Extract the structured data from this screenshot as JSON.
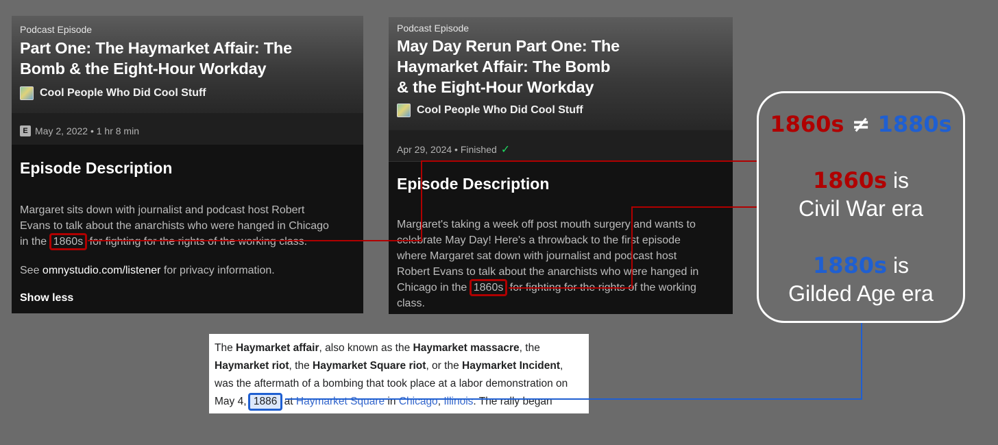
{
  "left_card": {
    "kicker": "Podcast Episode",
    "title_line1": "Part One: The Haymarket Affair: The",
    "title_line2": "Bomb & the Eight-Hour Workday",
    "show_name": "Cool People Who Did Cool Stuff",
    "explicit_badge": "E",
    "meta": "May 2, 2022 • 1 hr 8 min",
    "description_heading": "Episode Description",
    "desc_line1": "Margaret sits down with journalist and podcast host Robert",
    "desc_line2": "Evans to talk about the anarchists who were hanged in Chicago",
    "desc_line3_pre": "in the",
    "desc_decade": "1860s",
    "desc_line3_post": "for fighting for the rights of the working class.",
    "privacy_pre": "See",
    "privacy_link": "omnystudio.com/listener",
    "privacy_post": "for privacy information.",
    "show_less": "Show less"
  },
  "right_card": {
    "kicker": "Podcast Episode",
    "title_line1": "May Day Rerun Part One: The",
    "title_line2": "Haymarket Affair: The Bomb",
    "title_line3": "& the Eight-Hour Workday",
    "show_name": "Cool People Who Did Cool Stuff",
    "meta": "Apr 29, 2024 • Finished",
    "finished_icon": "checkmark-icon",
    "description_heading": "Episode Description",
    "desc_line1": "Margaret's taking a week off post mouth surgery and wants to",
    "desc_line2": "celebrate May Day! Here's a throwback to the first episode",
    "desc_line3": "where Margaret sat down with journalist and podcast host",
    "desc_line4": "Robert Evans to talk about the anarchists who were hanged in",
    "desc_line5_pre": "Chicago in the",
    "desc_decade": "1860s",
    "desc_line5_post": "for fighting for the rights of the working",
    "desc_line6": "class."
  },
  "bubble": {
    "left_decade": "1860s",
    "neq": "≠",
    "right_decade": "1880s",
    "fact1_decade": "1860s",
    "fact1_is": "is",
    "fact1_era": "Civil War era",
    "fact2_decade": "1880s",
    "fact2_is": "is",
    "fact2_era": "Gilded Age era"
  },
  "wiki": {
    "t1": "The",
    "b1": "Haymarket affair",
    "t2": ", also known as the",
    "b2": "Haymarket massacre",
    "t3": ", the",
    "b3": "Haymarket riot",
    "t4": ", the",
    "b4": "Haymarket Square riot",
    "t5": ", or the",
    "b5": "Haymarket Incident",
    "t6": ",",
    "t7": "was the aftermath of a bombing that took place at a labor demonstration on",
    "t8": "May 4,",
    "year": "1886",
    "t9": "at",
    "link1": "Haymarket Square",
    "t10": "in",
    "link2": "Chicago",
    "t11": ",",
    "link3": "Illinois",
    "t12": ". The rally began"
  },
  "colors": {
    "highlight_red": "#b00000",
    "highlight_blue": "#1f5fd1",
    "background": "#6b6b6b"
  }
}
